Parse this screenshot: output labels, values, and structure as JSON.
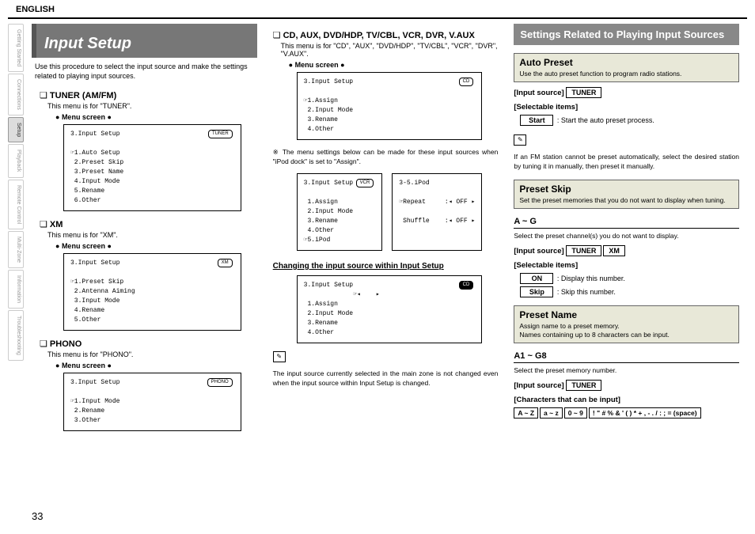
{
  "lang": "ENGLISH",
  "page_number": "33",
  "side_tabs": [
    "Getting Started",
    "Connections",
    "Setup",
    "Playback",
    "Remote Control",
    "Multi-Zone",
    "Information",
    "Troubleshooting"
  ],
  "active_tab_label": "Setup",
  "main_title": "Input Setup",
  "intro": "Use this procedure to select the input source and make the settings related to playing input sources.",
  "col1": {
    "tuner": {
      "heading": "TUNER (AM/FM)",
      "desc": "This menu is for \"TUNER\".",
      "menu_label": "Menu screen",
      "badge": "TUNER",
      "screen": "3.Input Setup\n\n☞1.Auto Setup\n 2.Preset Skip\n 3.Preset Name\n 4.Input Mode\n 5.Rename\n 6.Other"
    },
    "xm": {
      "heading": "XM",
      "desc": "This menu is for \"XM\".",
      "menu_label": "Menu screen",
      "badge": "XM",
      "screen": "3.Input Setup\n\n☞1.Preset Skip\n 2.Antenna Aiming\n 3.Input Mode\n 4.Rename\n 5.Other"
    },
    "phono": {
      "heading": "PHONO",
      "desc": "This menu is for \"PHONO\".",
      "menu_label": "Menu screen",
      "badge": "PHONO",
      "screen": "3.Input Setup\n\n☞1.Input Mode\n 2.Rename\n 3.Other"
    }
  },
  "col2": {
    "heading": "CD, AUX, DVD/HDP, TV/CBL, VCR, DVR, V.AUX",
    "desc": "This menu is for \"CD\", \"AUX\", \"DVD/HDP\", \"TV/CBL\", \"VCR\", \"DVR\", \"V.AUX\".",
    "menu_label": "Menu screen",
    "badge1": "CD",
    "screen1": "3.Input Setup\n\n☞1.Assign\n 2.Input Mode\n 3.Rename\n 4.Other",
    "ipod_note": "The menu settings below can be made for these input sources when \"iPod dock\" is set to \"Assign\".",
    "badge2a": "VCR",
    "screen2a": "3.Input Setup\n\n 1.Assign\n 2.Input Mode\n 3.Rename\n 4.Other\n☞5.iPod",
    "screen2b": "3-5.iPod\n\n☞Repeat     :◂ OFF ▸\n\n Shuffle    :◂ OFF ▸",
    "change_heading": "Changing the input source within Input Setup",
    "badge3": "CD",
    "screen3": "3.Input Setup\n             ☞◂    ▸\n 1.Assign\n 2.Input Mode\n 3.Rename\n 4.Other",
    "change_note": "The input source currently selected in the main zone is not changed even when the input source within Input Setup is changed."
  },
  "col3": {
    "header": "Settings Related to Playing Input Sources",
    "auto_preset": {
      "title": "Auto Preset",
      "desc": "Use the auto preset function to program radio stations.",
      "input_source_label": "[Input source]",
      "input_source_val": "TUNER",
      "selectable_label": "[Selectable items]",
      "item1": "Start",
      "item1_desc": ": Start the auto preset process.",
      "note": "If an FM station cannot be preset automatically, select the desired station by tuning it in manually, then preset it manually."
    },
    "preset_skip": {
      "title": "Preset Skip",
      "desc": "Set the preset memories that you do not want to display when tuning.",
      "range_h": "A ~ G",
      "range_desc": "Select the preset channel(s) you do not want to display.",
      "input_source_label": "[Input source]",
      "src1": "TUNER",
      "src2": "XM",
      "selectable_label": "[Selectable items]",
      "item1": "ON",
      "item1_desc": ": Display this number.",
      "item2": "Skip",
      "item2_desc": ": Skip this number."
    },
    "preset_name": {
      "title": "Preset Name",
      "desc": "Assign name to a preset memory.\nNames containing up to 8 characters can be input.",
      "range_h": "A1 ~ G8",
      "range_desc": "Select the preset memory number.",
      "input_source_label": "[Input source]",
      "src1": "TUNER",
      "chars_label": "[Characters that can be input]",
      "c1": "A ~ Z",
      "c2": "a ~ z",
      "c3": "0 ~ 9",
      "c4": "! \" # % & ' ( ) * + , - . / : ; = (space)"
    }
  }
}
